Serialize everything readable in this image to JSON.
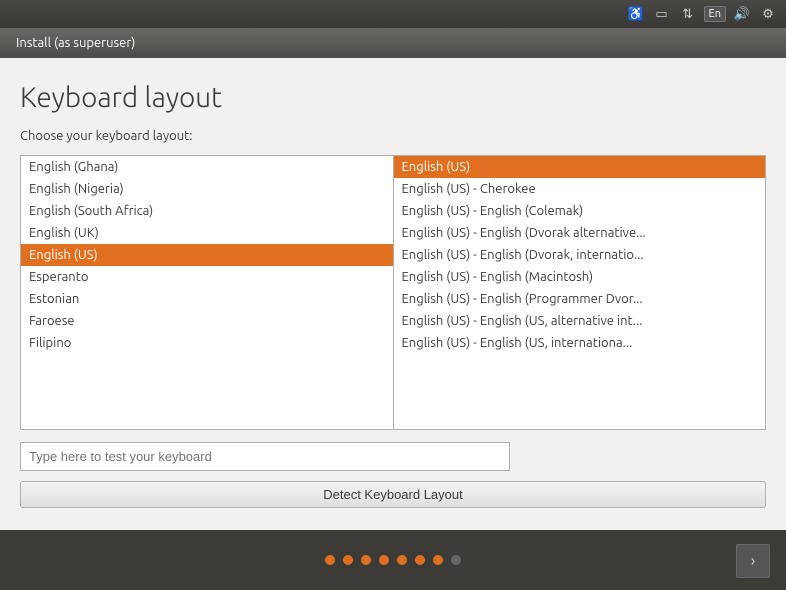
{
  "topbar": {
    "lang": "En"
  },
  "titlebar": {
    "label": "Install (as superuser)"
  },
  "page": {
    "title": "Keyboard layout",
    "subtitle": "Choose your keyboard layout:"
  },
  "left_list": {
    "items": [
      {
        "label": "English (Ghana)",
        "selected": false
      },
      {
        "label": "English (Nigeria)",
        "selected": false
      },
      {
        "label": "English (South Africa)",
        "selected": false
      },
      {
        "label": "English (UK)",
        "selected": false
      },
      {
        "label": "English (US)",
        "selected": true
      },
      {
        "label": "Esperanto",
        "selected": false
      },
      {
        "label": "Estonian",
        "selected": false
      },
      {
        "label": "Faroese",
        "selected": false
      },
      {
        "label": "Filipino",
        "selected": false
      }
    ]
  },
  "right_list": {
    "items": [
      {
        "label": "English (US)",
        "selected": true
      },
      {
        "label": "English (US) - Cherokee",
        "selected": false
      },
      {
        "label": "English (US) - English (Colemak)",
        "selected": false
      },
      {
        "label": "English (US) - English (Dvorak alternative...",
        "selected": false
      },
      {
        "label": "English (US) - English (Dvorak, internatio...",
        "selected": false
      },
      {
        "label": "English (US) - English (Macintosh)",
        "selected": false
      },
      {
        "label": "English (US) - English (Programmer Dvor...",
        "selected": false
      },
      {
        "label": "English (US) - English (US, alternative int...",
        "selected": false
      },
      {
        "label": "English (US) - English (US, internationa...",
        "selected": false
      }
    ]
  },
  "test_input": {
    "placeholder": "Type here to test your keyboard"
  },
  "detect_button": {
    "label": "Detect Keyboard Layout"
  },
  "dots": [
    {
      "active": true
    },
    {
      "active": true
    },
    {
      "active": true
    },
    {
      "active": true
    },
    {
      "active": true
    },
    {
      "active": true
    },
    {
      "active": true
    },
    {
      "active": false
    }
  ]
}
